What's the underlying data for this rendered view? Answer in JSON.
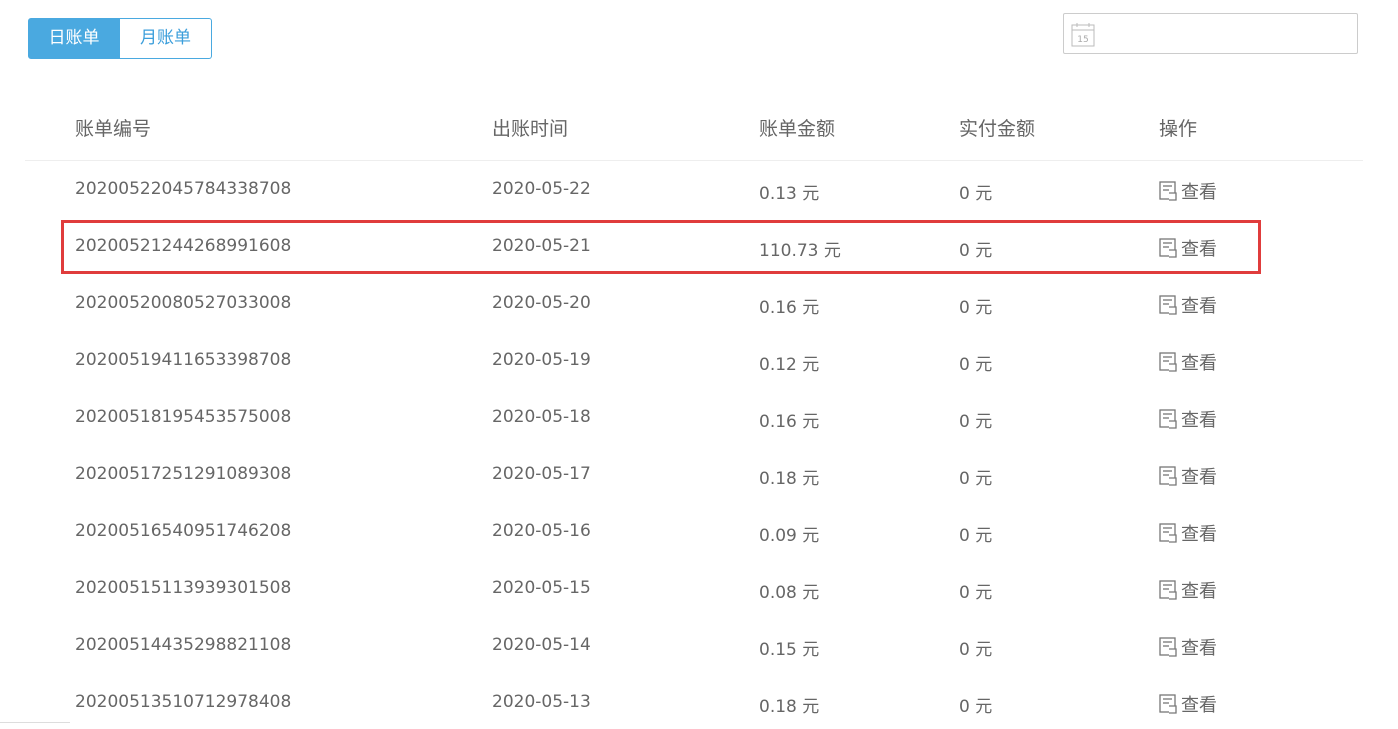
{
  "tabs": [
    {
      "label": "日账单",
      "active": true
    },
    {
      "label": "月账单",
      "active": false
    }
  ],
  "date_filter": {
    "icon": "calendar-icon",
    "calendar_day": "15",
    "value": "",
    "placeholder": ""
  },
  "table": {
    "headers": {
      "bill_no": "账单编号",
      "bill_date": "出账时间",
      "bill_amount": "账单金额",
      "paid_amount": "实付金额",
      "action": "操作"
    },
    "rows": [
      {
        "bill_no": "2020052204578433870​8",
        "bill_date": "2020-05-22",
        "bill_amount": "0.13 元",
        "paid_amount": "0 元",
        "action": "查看"
      },
      {
        "bill_no": "20200521244268991608",
        "bill_date": "2020-05-21",
        "bill_amount": "110.73 元",
        "paid_amount": "0 元",
        "action": "查看"
      },
      {
        "bill_no": "20200520080527033008",
        "bill_date": "2020-05-20",
        "bill_amount": "0.16 元",
        "paid_amount": "0 元",
        "action": "查看"
      },
      {
        "bill_no": "20200519411653398708",
        "bill_date": "2020-05-19",
        "bill_amount": "0.12 元",
        "paid_amount": "0 元",
        "action": "查看"
      },
      {
        "bill_no": "20200518195453575008",
        "bill_date": "2020-05-18",
        "bill_amount": "0.16 元",
        "paid_amount": "0 元",
        "action": "查看"
      },
      {
        "bill_no": "20200517251291089308",
        "bill_date": "2020-05-17",
        "bill_amount": "0.18 元",
        "paid_amount": "0 元",
        "action": "查看"
      },
      {
        "bill_no": "20200516540951746208",
        "bill_date": "2020-05-16",
        "bill_amount": "0.09 元",
        "paid_amount": "0 元",
        "action": "查看"
      },
      {
        "bill_no": "20200515113939301508",
        "bill_date": "2020-05-15",
        "bill_amount": "0.08 元",
        "paid_amount": "0 元",
        "action": "查看"
      },
      {
        "bill_no": "20200514435298821108",
        "bill_date": "2020-05-14",
        "bill_amount": "0.15 元",
        "paid_amount": "0 元",
        "action": "查看"
      },
      {
        "bill_no": "20200513510712978408",
        "bill_date": "2020-05-13",
        "bill_amount": "0.18 元",
        "paid_amount": "0 元",
        "action": "查看"
      }
    ]
  },
  "colors": {
    "accent": "#4aa9e0",
    "highlight": "#e03c3c",
    "text": "#666666"
  }
}
